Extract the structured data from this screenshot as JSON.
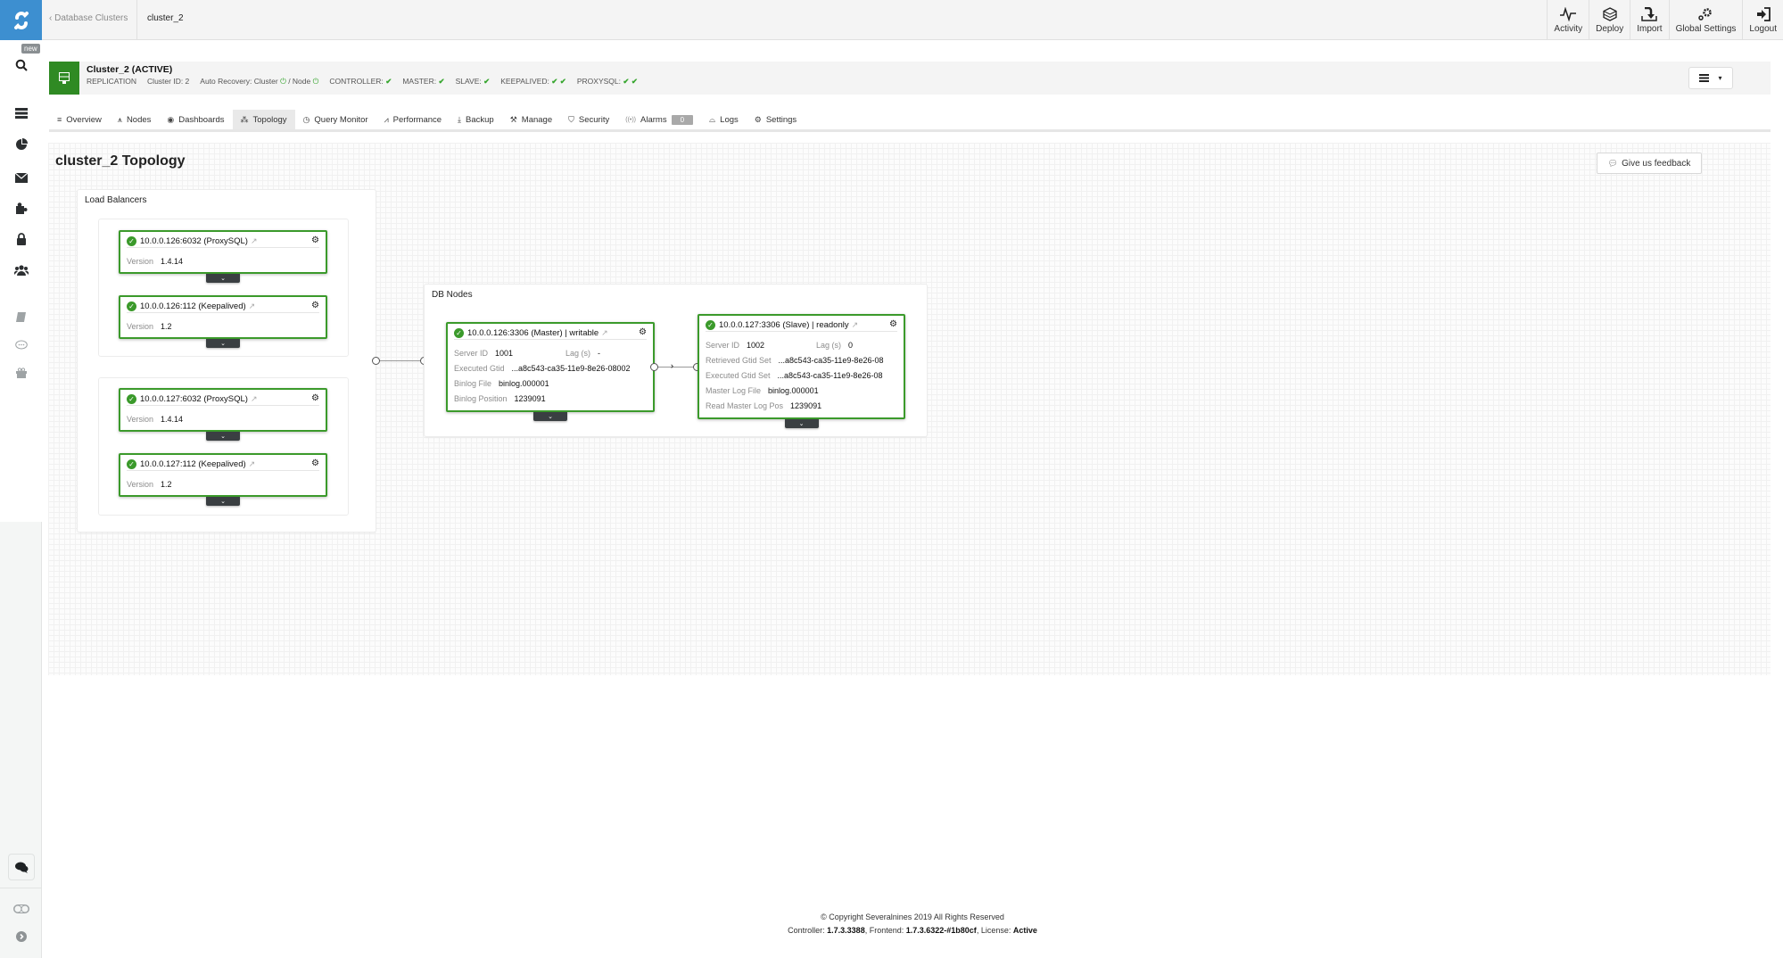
{
  "sidebar": {
    "new_badge": "new",
    "icons": [
      "search-icon",
      "clusters-icon",
      "dashboard-pie-icon",
      "mail-icon",
      "integrations-puzzle-icon",
      "lock-icon",
      "users-icon",
      "docs-book-icon",
      "comment-icon",
      "gift-icon"
    ],
    "chat_icon": "chat-bubbles-icon",
    "toggle_icon": "toggle-icon",
    "expand_icon": "chevron-circle-right-icon"
  },
  "topbar": {
    "back_label": "Database Clusters",
    "current": "cluster_2",
    "nav": [
      {
        "label": "Activity",
        "icon": "activity-icon"
      },
      {
        "label": "Deploy",
        "icon": "deploy-cube-icon"
      },
      {
        "label": "Import",
        "icon": "import-icon"
      },
      {
        "label": "Global Settings",
        "icon": "gears-icon"
      },
      {
        "label": "Logout",
        "icon": "logout-icon"
      }
    ]
  },
  "cluster": {
    "title": "Cluster_2 (ACTIVE)",
    "type": "REPLICATION",
    "cluster_id": "Cluster ID: 2",
    "auto_recovery_label": "Auto Recovery: Cluster",
    "auto_recovery_node": "/ Node",
    "statuses": [
      {
        "label": "CONTROLLER:",
        "checks": "✔"
      },
      {
        "label": "MASTER:",
        "checks": "✔"
      },
      {
        "label": "SLAVE:",
        "checks": "✔"
      },
      {
        "label": "KEEPALIVED:",
        "checks": "✔ ✔"
      },
      {
        "label": "PROXYSQL:",
        "checks": "✔ ✔"
      }
    ],
    "status_color": "#2f8a23"
  },
  "tabs": [
    {
      "label": "Overview",
      "icon": "≡"
    },
    {
      "label": "Nodes",
      "icon": "⩚"
    },
    {
      "label": "Dashboards",
      "icon": "◉"
    },
    {
      "label": "Topology",
      "icon": "⁂",
      "active": true
    },
    {
      "label": "Query Monitor",
      "icon": "◷"
    },
    {
      "label": "Performance",
      "icon": "⩘"
    },
    {
      "label": "Backup",
      "icon": "⤓"
    },
    {
      "label": "Manage",
      "icon": "⚒"
    },
    {
      "label": "Security",
      "icon": "⛉"
    },
    {
      "label": "Alarms",
      "icon": "((•))",
      "badge": "0"
    },
    {
      "label": "Logs",
      "icon": "⌓"
    },
    {
      "label": "Settings",
      "icon": "⚙"
    }
  ],
  "page": {
    "title": "cluster_2 Topology",
    "feedback_label": "Give us feedback"
  },
  "load_balancers": {
    "title": "Load Balancers",
    "groups": [
      {
        "nodes": [
          {
            "title": "10.0.0.126:6032 (ProxySQL)",
            "version_label": "Version",
            "version": "1.4.14"
          },
          {
            "title": "10.0.0.126:112 (Keepalived)",
            "version_label": "Version",
            "version": "1.2"
          }
        ]
      },
      {
        "nodes": [
          {
            "title": "10.0.0.127:6032 (ProxySQL)",
            "version_label": "Version",
            "version": "1.4.14"
          },
          {
            "title": "10.0.0.127:112 (Keepalived)",
            "version_label": "Version",
            "version": "1.2"
          }
        ]
      }
    ]
  },
  "db_nodes": {
    "title": "DB Nodes",
    "master": {
      "title": "10.0.0.126:3306 (Master) | writable",
      "server_id_label": "Server ID",
      "server_id": "1001",
      "lag_label": "Lag (s)",
      "lag": "-",
      "rows": [
        {
          "k": "Executed Gtid",
          "v": "...a8c543-ca35-11e9-8e26-08002"
        },
        {
          "k": "Binlog File",
          "v": "binlog.000001"
        },
        {
          "k": "Binlog Position",
          "v": "1239091"
        }
      ]
    },
    "slave": {
      "title": "10.0.0.127:3306 (Slave) | readonly",
      "server_id_label": "Server ID",
      "server_id": "1002",
      "lag_label": "Lag (s)",
      "lag": "0",
      "rows": [
        {
          "k": "Retrieved Gtid Set",
          "v": "...a8c543-ca35-11e9-8e26-08"
        },
        {
          "k": "Executed Gtid Set",
          "v": "...a8c543-ca35-11e9-8e26-08"
        },
        {
          "k": "Master Log File",
          "v": "binlog.000001"
        },
        {
          "k": "Read Master Log Pos",
          "v": "1239091"
        }
      ]
    }
  },
  "footer": {
    "copyright": "© Copyright Severalnines 2019 All Rights Reserved",
    "controller_label": "Controller:",
    "controller": "1.7.3.3388",
    "frontend_label": ", Frontend:",
    "frontend": "1.7.3.6322-#1b80cf",
    "license_label": ", License:",
    "license": "Active"
  }
}
